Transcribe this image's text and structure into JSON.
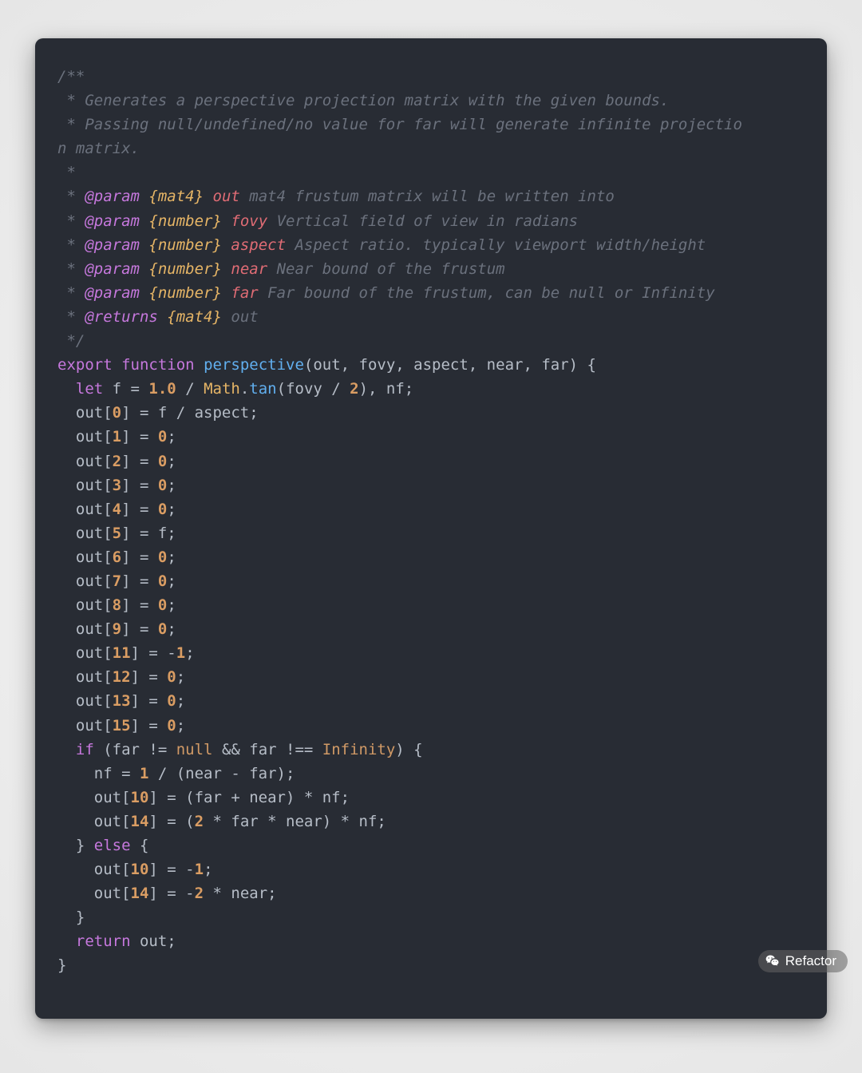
{
  "colors": {
    "page_bg": "#f0f0f0",
    "panel_bg": "#282c34",
    "comment": "#6b717d",
    "doctag": "#c678dd",
    "doctype": "#e6b566",
    "docvar": "#e06c75",
    "keyword": "#c678dd",
    "function": "#61afef",
    "number": "#da9d63",
    "object": "#e6b566",
    "constant": "#d19a66",
    "plain": "#b6bdc7"
  },
  "watermark": {
    "label": "Refactor"
  },
  "code": {
    "lines": [
      [
        {
          "t": "comment",
          "v": "/**"
        }
      ],
      [
        {
          "t": "comment",
          "v": " * Generates a perspective projection matrix with the given bounds."
        }
      ],
      [
        {
          "t": "comment",
          "v": " * Passing null/undefined/no value for far will generate infinite projectio"
        }
      ],
      [
        {
          "t": "comment",
          "v": "n matrix."
        }
      ],
      [
        {
          "t": "comment",
          "v": " *"
        }
      ],
      [
        {
          "t": "comment",
          "v": " * "
        },
        {
          "t": "doctag",
          "v": "@param"
        },
        {
          "t": "comment",
          "v": " "
        },
        {
          "t": "doctype",
          "v": "{mat4}"
        },
        {
          "t": "comment",
          "v": " "
        },
        {
          "t": "docvar",
          "v": "out"
        },
        {
          "t": "comment",
          "v": " mat4 frustum matrix will be written into"
        }
      ],
      [
        {
          "t": "comment",
          "v": " * "
        },
        {
          "t": "doctag",
          "v": "@param"
        },
        {
          "t": "comment",
          "v": " "
        },
        {
          "t": "doctype",
          "v": "{number}"
        },
        {
          "t": "comment",
          "v": " "
        },
        {
          "t": "docvar",
          "v": "fovy"
        },
        {
          "t": "comment",
          "v": " Vertical field of view in radians"
        }
      ],
      [
        {
          "t": "comment",
          "v": " * "
        },
        {
          "t": "doctag",
          "v": "@param"
        },
        {
          "t": "comment",
          "v": " "
        },
        {
          "t": "doctype",
          "v": "{number}"
        },
        {
          "t": "comment",
          "v": " "
        },
        {
          "t": "docvar",
          "v": "aspect"
        },
        {
          "t": "comment",
          "v": " Aspect ratio. typically viewport width/height"
        }
      ],
      [
        {
          "t": "comment",
          "v": " * "
        },
        {
          "t": "doctag",
          "v": "@param"
        },
        {
          "t": "comment",
          "v": " "
        },
        {
          "t": "doctype",
          "v": "{number}"
        },
        {
          "t": "comment",
          "v": " "
        },
        {
          "t": "docvar",
          "v": "near"
        },
        {
          "t": "comment",
          "v": " Near bound of the frustum"
        }
      ],
      [
        {
          "t": "comment",
          "v": " * "
        },
        {
          "t": "doctag",
          "v": "@param"
        },
        {
          "t": "comment",
          "v": " "
        },
        {
          "t": "doctype",
          "v": "{number}"
        },
        {
          "t": "comment",
          "v": " "
        },
        {
          "t": "docvar",
          "v": "far"
        },
        {
          "t": "comment",
          "v": " Far bound of the frustum, can be null or Infinity"
        }
      ],
      [
        {
          "t": "comment",
          "v": " * "
        },
        {
          "t": "doctag",
          "v": "@returns"
        },
        {
          "t": "comment",
          "v": " "
        },
        {
          "t": "doctype",
          "v": "{mat4}"
        },
        {
          "t": "comment",
          "v": " out"
        }
      ],
      [
        {
          "t": "comment",
          "v": " */"
        }
      ],
      [
        {
          "t": "keyword",
          "v": "export"
        },
        {
          "t": "plain",
          "v": " "
        },
        {
          "t": "keyword",
          "v": "function"
        },
        {
          "t": "plain",
          "v": " "
        },
        {
          "t": "func",
          "v": "perspective"
        },
        {
          "t": "plain",
          "v": "(out, fovy, aspect, near, far) {"
        }
      ],
      [
        {
          "t": "plain",
          "v": "  "
        },
        {
          "t": "keyword",
          "v": "let"
        },
        {
          "t": "plain",
          "v": " f = "
        },
        {
          "t": "number",
          "v": "1.0"
        },
        {
          "t": "plain",
          "v": " / "
        },
        {
          "t": "obj",
          "v": "Math"
        },
        {
          "t": "plain",
          "v": "."
        },
        {
          "t": "func",
          "v": "tan"
        },
        {
          "t": "plain",
          "v": "(fovy / "
        },
        {
          "t": "number",
          "v": "2"
        },
        {
          "t": "plain",
          "v": "), nf;"
        }
      ],
      [
        {
          "t": "plain",
          "v": "  out["
        },
        {
          "t": "number",
          "v": "0"
        },
        {
          "t": "plain",
          "v": "] = f / aspect;"
        }
      ],
      [
        {
          "t": "plain",
          "v": "  out["
        },
        {
          "t": "number",
          "v": "1"
        },
        {
          "t": "plain",
          "v": "] = "
        },
        {
          "t": "number",
          "v": "0"
        },
        {
          "t": "plain",
          "v": ";"
        }
      ],
      [
        {
          "t": "plain",
          "v": "  out["
        },
        {
          "t": "number",
          "v": "2"
        },
        {
          "t": "plain",
          "v": "] = "
        },
        {
          "t": "number",
          "v": "0"
        },
        {
          "t": "plain",
          "v": ";"
        }
      ],
      [
        {
          "t": "plain",
          "v": "  out["
        },
        {
          "t": "number",
          "v": "3"
        },
        {
          "t": "plain",
          "v": "] = "
        },
        {
          "t": "number",
          "v": "0"
        },
        {
          "t": "plain",
          "v": ";"
        }
      ],
      [
        {
          "t": "plain",
          "v": "  out["
        },
        {
          "t": "number",
          "v": "4"
        },
        {
          "t": "plain",
          "v": "] = "
        },
        {
          "t": "number",
          "v": "0"
        },
        {
          "t": "plain",
          "v": ";"
        }
      ],
      [
        {
          "t": "plain",
          "v": "  out["
        },
        {
          "t": "number",
          "v": "5"
        },
        {
          "t": "plain",
          "v": "] = f;"
        }
      ],
      [
        {
          "t": "plain",
          "v": "  out["
        },
        {
          "t": "number",
          "v": "6"
        },
        {
          "t": "plain",
          "v": "] = "
        },
        {
          "t": "number",
          "v": "0"
        },
        {
          "t": "plain",
          "v": ";"
        }
      ],
      [
        {
          "t": "plain",
          "v": "  out["
        },
        {
          "t": "number",
          "v": "7"
        },
        {
          "t": "plain",
          "v": "] = "
        },
        {
          "t": "number",
          "v": "0"
        },
        {
          "t": "plain",
          "v": ";"
        }
      ],
      [
        {
          "t": "plain",
          "v": "  out["
        },
        {
          "t": "number",
          "v": "8"
        },
        {
          "t": "plain",
          "v": "] = "
        },
        {
          "t": "number",
          "v": "0"
        },
        {
          "t": "plain",
          "v": ";"
        }
      ],
      [
        {
          "t": "plain",
          "v": "  out["
        },
        {
          "t": "number",
          "v": "9"
        },
        {
          "t": "plain",
          "v": "] = "
        },
        {
          "t": "number",
          "v": "0"
        },
        {
          "t": "plain",
          "v": ";"
        }
      ],
      [
        {
          "t": "plain",
          "v": "  out["
        },
        {
          "t": "number",
          "v": "11"
        },
        {
          "t": "plain",
          "v": "] = -"
        },
        {
          "t": "number",
          "v": "1"
        },
        {
          "t": "plain",
          "v": ";"
        }
      ],
      [
        {
          "t": "plain",
          "v": "  out["
        },
        {
          "t": "number",
          "v": "12"
        },
        {
          "t": "plain",
          "v": "] = "
        },
        {
          "t": "number",
          "v": "0"
        },
        {
          "t": "plain",
          "v": ";"
        }
      ],
      [
        {
          "t": "plain",
          "v": "  out["
        },
        {
          "t": "number",
          "v": "13"
        },
        {
          "t": "plain",
          "v": "] = "
        },
        {
          "t": "number",
          "v": "0"
        },
        {
          "t": "plain",
          "v": ";"
        }
      ],
      [
        {
          "t": "plain",
          "v": "  out["
        },
        {
          "t": "number",
          "v": "15"
        },
        {
          "t": "plain",
          "v": "] = "
        },
        {
          "t": "number",
          "v": "0"
        },
        {
          "t": "plain",
          "v": ";"
        }
      ],
      [
        {
          "t": "plain",
          "v": "  "
        },
        {
          "t": "keyword",
          "v": "if"
        },
        {
          "t": "plain",
          "v": " (far != "
        },
        {
          "t": "const",
          "v": "null"
        },
        {
          "t": "plain",
          "v": " && far !== "
        },
        {
          "t": "const",
          "v": "Infinity"
        },
        {
          "t": "plain",
          "v": ") {"
        }
      ],
      [
        {
          "t": "plain",
          "v": "    nf = "
        },
        {
          "t": "number",
          "v": "1"
        },
        {
          "t": "plain",
          "v": " / (near - far);"
        }
      ],
      [
        {
          "t": "plain",
          "v": "    out["
        },
        {
          "t": "number",
          "v": "10"
        },
        {
          "t": "plain",
          "v": "] = (far + near) * nf;"
        }
      ],
      [
        {
          "t": "plain",
          "v": "    out["
        },
        {
          "t": "number",
          "v": "14"
        },
        {
          "t": "plain",
          "v": "] = ("
        },
        {
          "t": "number",
          "v": "2"
        },
        {
          "t": "plain",
          "v": " * far * near) * nf;"
        }
      ],
      [
        {
          "t": "plain",
          "v": "  } "
        },
        {
          "t": "keyword",
          "v": "else"
        },
        {
          "t": "plain",
          "v": " {"
        }
      ],
      [
        {
          "t": "plain",
          "v": "    out["
        },
        {
          "t": "number",
          "v": "10"
        },
        {
          "t": "plain",
          "v": "] = -"
        },
        {
          "t": "number",
          "v": "1"
        },
        {
          "t": "plain",
          "v": ";"
        }
      ],
      [
        {
          "t": "plain",
          "v": "    out["
        },
        {
          "t": "number",
          "v": "14"
        },
        {
          "t": "plain",
          "v": "] = -"
        },
        {
          "t": "number",
          "v": "2"
        },
        {
          "t": "plain",
          "v": " * near;"
        }
      ],
      [
        {
          "t": "plain",
          "v": "  }"
        }
      ],
      [
        {
          "t": "plain",
          "v": "  "
        },
        {
          "t": "keyword",
          "v": "return"
        },
        {
          "t": "plain",
          "v": " out;"
        }
      ],
      [
        {
          "t": "plain",
          "v": "}"
        }
      ]
    ]
  }
}
